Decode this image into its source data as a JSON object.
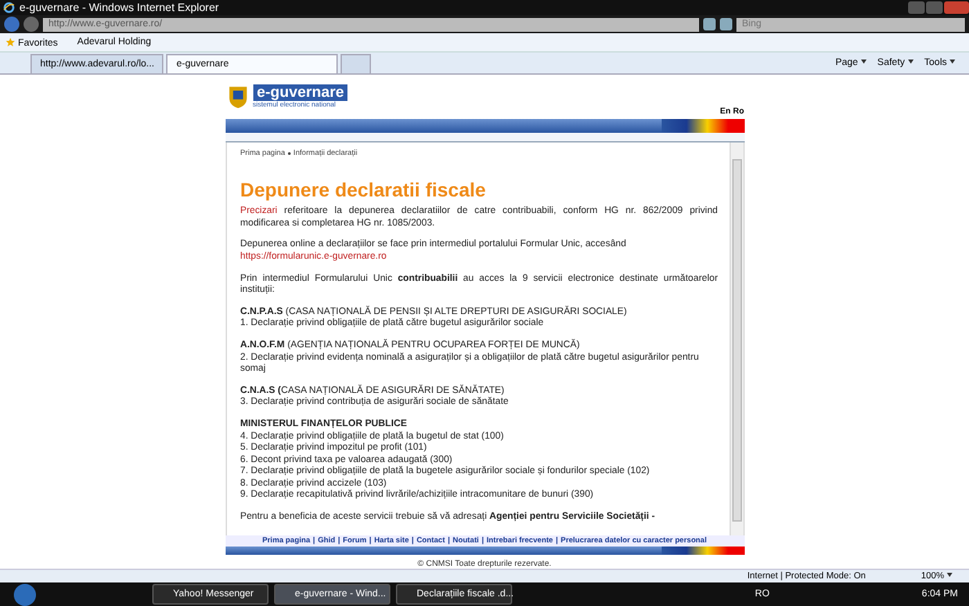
{
  "window": {
    "title": "e-guvernare - Windows Internet Explorer"
  },
  "address_bar": {
    "url": "http://www.e-guvernare.ro/",
    "search_placeholder": "Bing"
  },
  "favorites_bar": {
    "favorites": "Favorites",
    "items": [
      "Adevarul Holding"
    ]
  },
  "tabs": [
    {
      "label": "http://www.adevarul.ro/lo...",
      "selected": false
    },
    {
      "label": "e-guvernare",
      "selected": true
    }
  ],
  "command_bar": [
    "Page",
    "Safety",
    "Tools"
  ],
  "page": {
    "logo_title": "e-guvernare",
    "logo_subtitle": "sistemul electronic national",
    "languages": "En Ro",
    "breadcrumb": [
      "Prima pagina",
      "Informații declarații"
    ],
    "heading": "Depunere declaratii fiscale",
    "intro": [
      {
        "link": "Precizari",
        "text": "referitoare la depunerea declaratiilor de catre contribuabili, conform HG nr. 862/2009 privind modificarea si completarea HG nr. 1085/2003."
      },
      {
        "text": "Depunerea online a declarațiilor se face prin intermediul portalului Formular Unic, accesând",
        "link_after": "https://formularunic.e-guvernare.ro"
      },
      {
        "text": "Prin intermediul Formularului Unic **contribuabilii** au acces la 9 servicii electronice destinate următoarelor instituții:"
      }
    ],
    "sections": [
      {
        "heading": "**C.N.P.A.S** (CASA NAȚIONALĂ DE PENSII ȘI ALTE DREPTURI DE ASIGURĂRI SOCIALE)",
        "items": [
          "1. Declarație privind obligațiile de plată către bugetul asigurărilor sociale"
        ]
      },
      {
        "heading": "**A.N.O.F.M** (AGENȚIA NAȚIONALĂ PENTRU OCUPAREA FORȚEI DE MUNCĂ)",
        "items": [
          "2. Declarație privind evidența nominală a asiguraților și a obligațiilor de plată către bugetul asigurărilor pentru somaj"
        ]
      },
      {
        "heading": "**C.N.A.S (**CASA NAȚIONALĂ DE ASIGURĂRI DE SĂNĂTATE)",
        "items": [
          "3. Declarație privind contribuția de asigurări sociale de sănătate"
        ]
      },
      {
        "heading": "**MINISTERUL FINANȚELOR PUBLICE**",
        "items": [
          "4. Declarație privind obligațiile de plată la bugetul de stat (100)",
          "5. Declarație privind impozitul pe profit (101)",
          "6. Decont privind taxa pe valoarea adaugată (300)",
          "7. Declarație privind obligațiile de plată la bugetele asigurărilor sociale și fondurilor speciale (102)",
          "8. Declarație privind accizele (103)",
          "9. Declarație recapitulativă privind livrările/achizițiile intracomunitare de bunuri (390)"
        ]
      }
    ],
    "closing": "Pentru a beneficia de aceste servicii trebuie să vă adresați **Agenției pentru Serviciile Societății -**",
    "footer_links": [
      "Prima pagina",
      "Ghid",
      "Forum",
      "Harta site",
      "Contact",
      "Noutati",
      "Intrebari frecvente",
      "Prelucrarea datelor cu caracter personal"
    ],
    "footer_separator": "|",
    "copyright": "© CNMSI Toate drepturile rezervate."
  },
  "status_bar": {
    "zone": "Internet | Protected Mode: On",
    "zoom": "100%"
  },
  "taskbar": {
    "windows": [
      {
        "label": "Yahoo! Messenger",
        "selected": false
      },
      {
        "label": "e-guvernare - Wind...",
        "selected": true
      },
      {
        "label": "Declarațiile fiscale .d...",
        "selected": false
      }
    ],
    "language": "RO",
    "clock": "6:04 PM"
  }
}
